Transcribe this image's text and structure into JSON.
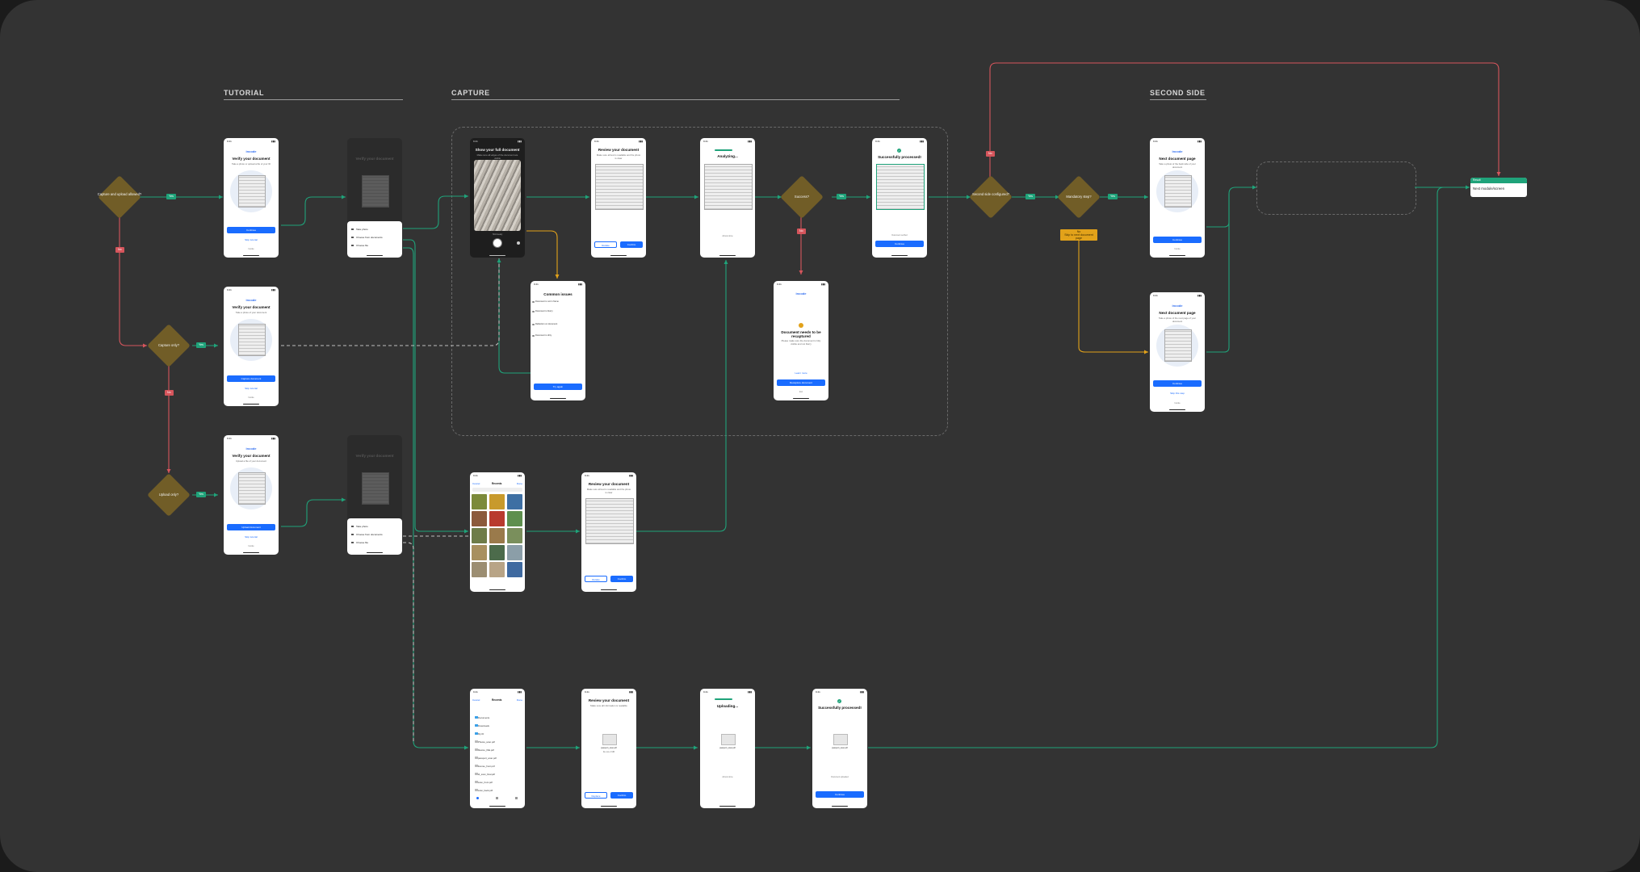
{
  "sections": {
    "tutorial": "TUTORIAL",
    "capture": "CAPTURE",
    "second_side": "SECOND SIDE"
  },
  "labels": {
    "yes": "Yes",
    "no": "No"
  },
  "decisions": {
    "capture_upload": "Capture and upload allowed?",
    "capture_only": "Capture only?",
    "upload_only": "Upload only?",
    "success": "Success?",
    "second_side": "Second side configured?",
    "mandatory": "Mandatory step?"
  },
  "warning": {
    "title": "No",
    "body": "Skip to next document page"
  },
  "tutorial_screens": [
    {
      "brand": "incode",
      "title": "Verify your document",
      "subtitle": "Take a photo or upload a file of your ID",
      "primary": "Continue",
      "link": "Skip tutorial",
      "footer": "Incode"
    },
    {
      "brand": "incode",
      "title": "Verify your document",
      "subtitle": "Take a photo of your document",
      "primary": "Capture document",
      "link": "Skip tutorial",
      "footer": "Incode"
    },
    {
      "brand": "incode",
      "title": "Verify your document",
      "subtitle": "Upload a file of your document",
      "primary": "Upload document",
      "link": "Skip tutorial",
      "footer": "Incode"
    }
  ],
  "source_sheet": {
    "items": [
      "Take photo",
      "Choose from documents",
      "Choose file"
    ]
  },
  "capture": {
    "camera_title": "Show your full document",
    "camera_sub": "Make sure all edges of the document are visible",
    "camera_hint": "Hold steady",
    "review_title": "Review your document",
    "review_sub": "Make sure all text is readable and the photo is clear",
    "retake": "Retake",
    "confirm": "Confirm",
    "analyzing": "Analyzing...",
    "analyzing_hint": "Almost done",
    "success_title": "Successfully processed!",
    "success_hint": "Document verified",
    "continue": "Continue",
    "issues_title": "Common issues",
    "issues": [
      "Document is not in frame",
      "Document is blurry",
      "Reflection on document",
      "Document is dirty"
    ],
    "try_again": "Try again",
    "recapture_brand": "incode",
    "recapture_title": "Document needs to be recaptured",
    "recapture_sub": "Please make sure the document is fully visible and not blurry",
    "recapture_link": "Learn more",
    "recapture_btn": "Recapture document",
    "recapture_foot": "Exit"
  },
  "photo_picker": {
    "left": "Cancel",
    "title": "Recents",
    "right": "Done"
  },
  "file_picker": {
    "left": "Cancel",
    "title": "Recents",
    "right": "Done",
    "rows": [
      "Documents",
      "Downloads",
      "My ID",
      "Photos_scan.pdf",
      "Mexico_INE.pdf",
      "passport_scan.pdf",
      "license_front.pdf",
      "id_scan_final.pdf",
      "scan_front.pdf",
      "scan_back.pdf"
    ]
  },
  "upload": {
    "review_title": "Review your document",
    "review_sub": "Make sure all information is readable",
    "file_name": "passport_scan.pdf",
    "file_meta": "file size 2 MB",
    "retake": "Replace",
    "confirm": "Confirm",
    "uploading": "Uploading...",
    "uploading_hint": "Almost done",
    "success_title": "Successfully processed!",
    "success_hint": "Document uploaded",
    "continue": "Continue"
  },
  "second_side": {
    "screens": [
      {
        "brand": "incode",
        "title": "Next document page",
        "subtitle": "Take a photo of the back side of your document",
        "primary": "Continue",
        "link": "",
        "footer": "Incode"
      },
      {
        "brand": "incode",
        "title": "Next document page",
        "subtitle": "Take a photo of the next page of your document",
        "primary": "Continue",
        "link": "Skip this step",
        "footer": "Incode"
      }
    ]
  },
  "result": {
    "header": "Result",
    "body": "Next module/screen"
  },
  "colors": {
    "green": "#1fa37a",
    "red": "#d6555c",
    "amber": "#e2a21a",
    "decision": "#715d27",
    "primary": "#1a6cff"
  }
}
